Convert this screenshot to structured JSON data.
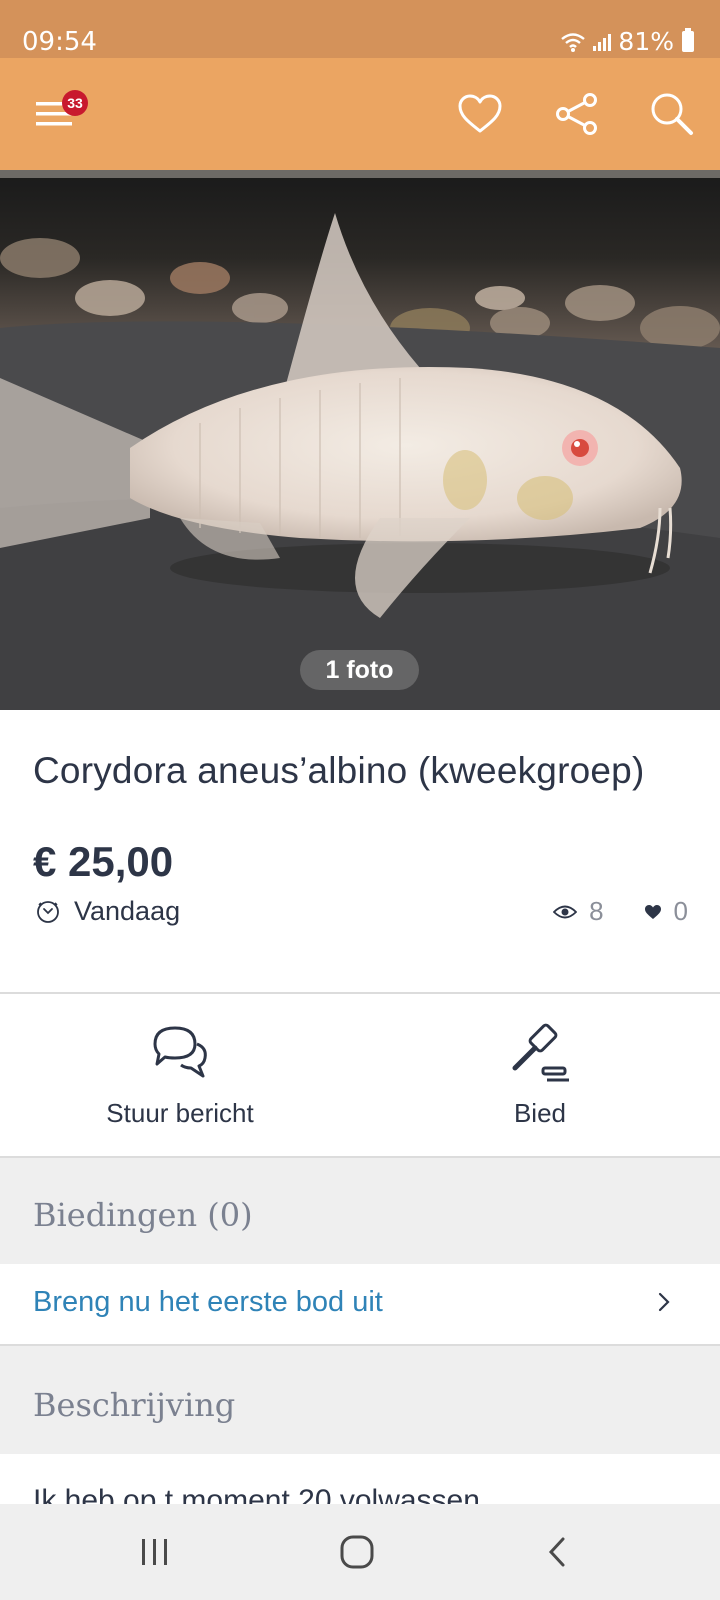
{
  "status_bar": {
    "time": "09:54",
    "battery": "81%"
  },
  "header": {
    "menu_badge": "33",
    "icons": [
      "menu-icon",
      "heart-icon",
      "share-icon",
      "search-icon"
    ],
    "color": "#eba562"
  },
  "photo": {
    "counter": "1 foto"
  },
  "listing": {
    "title": "Corydora aneus’albino (kweekgroep)",
    "price": "€ 25,00",
    "date": "Vandaag",
    "views": "8",
    "favorites": "0"
  },
  "actions": {
    "message_label": "Stuur bericht",
    "bid_label": "Bied"
  },
  "bids": {
    "heading": "Biedingen (0)",
    "cta": "Breng nu het eerste bod uit"
  },
  "description": {
    "heading": "Beschrijving",
    "text": "Ik heb op t moment 20 volwassen"
  },
  "colors": {
    "text": "#2d3547",
    "link": "#2f83b7",
    "badge": "#c8192e"
  }
}
